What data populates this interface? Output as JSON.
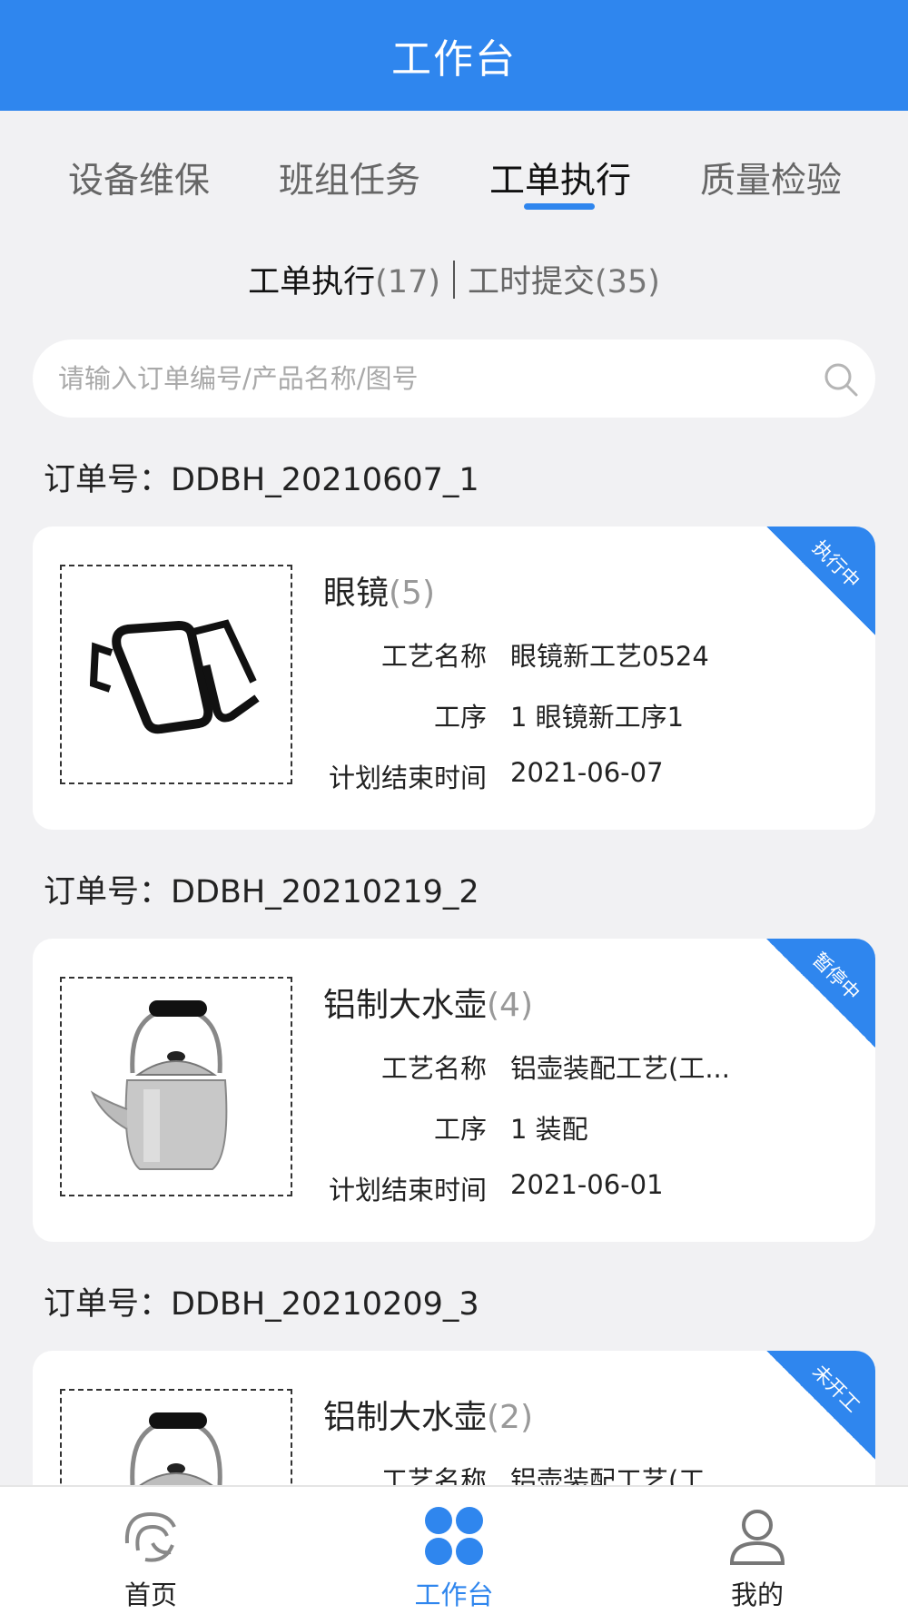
{
  "header": {
    "title": "工作台"
  },
  "tabs": [
    {
      "label": "设备维保",
      "active": false
    },
    {
      "label": "班组任务",
      "active": false
    },
    {
      "label": "工单执行",
      "active": true
    },
    {
      "label": "质量检验",
      "active": false
    }
  ],
  "subtabs": {
    "execute": {
      "label": "工单执行",
      "count": "(17)"
    },
    "hours": {
      "label": "工时提交",
      "count": "(35)"
    }
  },
  "search": {
    "placeholder": "请输入订单编号/产品名称/图号",
    "value": ""
  },
  "orders": [
    {
      "order_label": "订单号：DDBH_20210607_1",
      "product": "眼镜",
      "count": "(5)",
      "status": "执行中",
      "process_label": "工艺名称",
      "process": "眼镜新工艺0524",
      "step_label": "工序",
      "step": "1 眼镜新工序1",
      "end_label": "计划结束时间",
      "end": "2021-06-07",
      "image": "glasses"
    },
    {
      "order_label": "订单号：DDBH_20210219_2",
      "product": "铝制大水壶",
      "count": "(4)",
      "status": "暂停中",
      "process_label": "工艺名称",
      "process": "铝壶装配工艺(工...",
      "step_label": "工序",
      "step": "1 装配",
      "end_label": "计划结束时间",
      "end": "2021-06-01",
      "image": "kettle"
    },
    {
      "order_label": "订单号：DDBH_20210209_3",
      "product": "铝制大水壶",
      "count": "(2)",
      "status": "未开工",
      "process_label": "工艺名称",
      "process": "铝壶装配工艺(工...",
      "image": "kettle"
    }
  ],
  "tabbar": [
    {
      "label": "首页",
      "icon": "home-logo-icon",
      "active": false
    },
    {
      "label": "工作台",
      "icon": "grid-icon",
      "active": true
    },
    {
      "label": "我的",
      "icon": "user-icon",
      "active": false
    }
  ],
  "colors": {
    "primary": "#2f86ee",
    "background": "#f1f1f3"
  }
}
